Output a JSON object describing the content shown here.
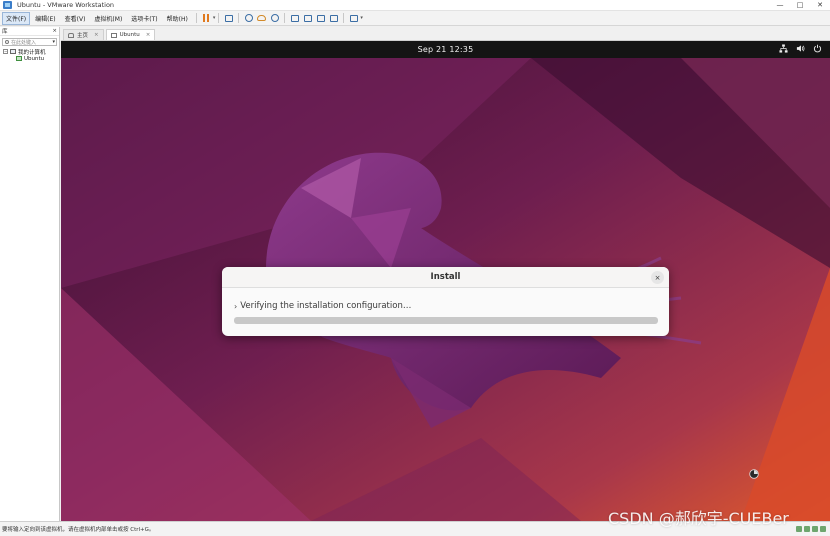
{
  "window": {
    "title": "Ubuntu - VMware Workstation",
    "minimize": "—",
    "maximize": "□",
    "close": "✕"
  },
  "menu": {
    "items": [
      "文件(F)",
      "编辑(E)",
      "查看(V)",
      "虚拟机(M)",
      "选项卡(T)",
      "帮助(H)"
    ]
  },
  "library": {
    "header": "库",
    "close": "×",
    "search_placeholder": "在此处键入",
    "tree_root": "我的计算机",
    "tree_child": "Ubuntu"
  },
  "tabs": [
    {
      "label": "主页"
    },
    {
      "label": "Ubuntu"
    }
  ],
  "tab_close": "×",
  "vm": {
    "clock": "Sep 21  12:35"
  },
  "dialog": {
    "title": "Install",
    "close": "×",
    "chevron": "›",
    "status": "Verifying the installation configuration…"
  },
  "statusbar": {
    "text": "要将输入定向到该虚拟机，请在虚拟机内部单击或按 Ctrl+G。"
  },
  "watermark": "CSDN @郝欣宇-CUEBer",
  "colors": {
    "ubuntu_topbar": "#141414",
    "wallpaper_dark": "#4a1438",
    "wallpaper_orange": "#e25a2a"
  }
}
